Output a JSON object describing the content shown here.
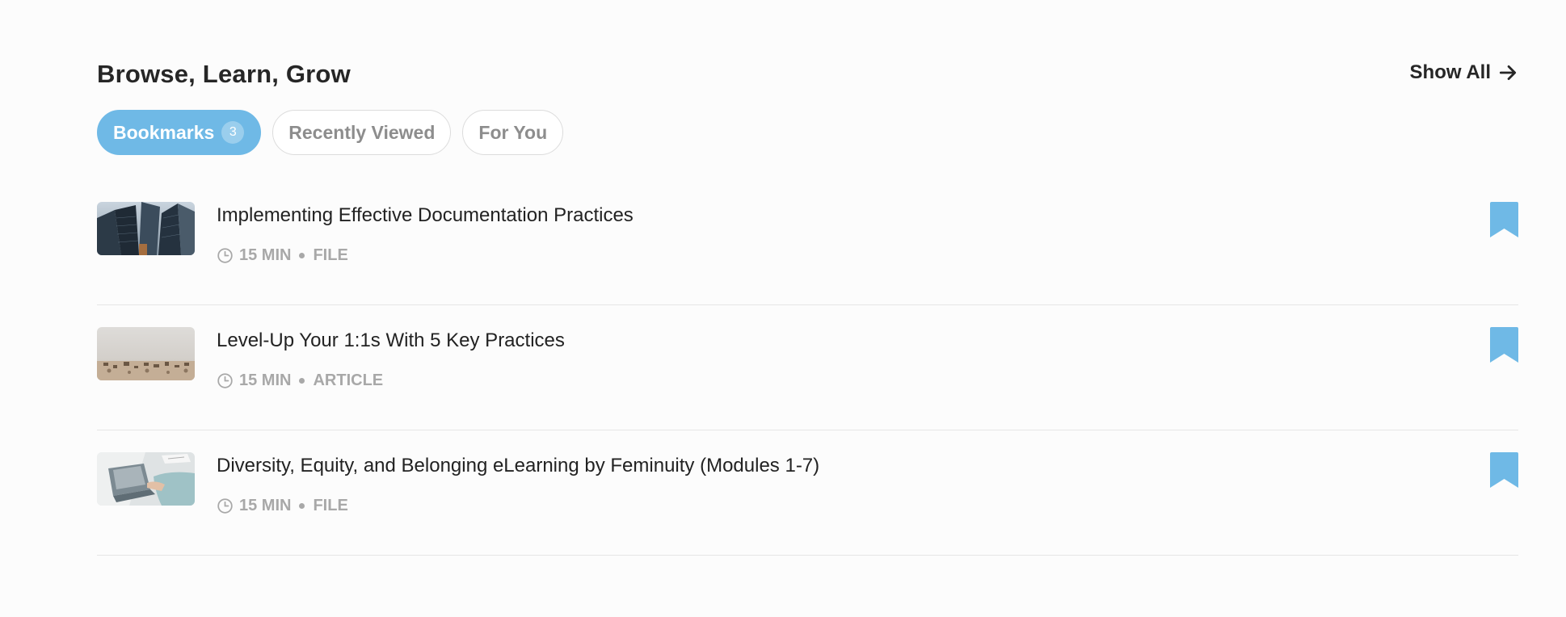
{
  "header": {
    "title": "Browse, Learn, Grow",
    "show_all_label": "Show All"
  },
  "tabs": [
    {
      "label": "Bookmarks",
      "count": "3",
      "active": true
    },
    {
      "label": "Recently Viewed",
      "active": false
    },
    {
      "label": "For You",
      "active": false
    }
  ],
  "items": [
    {
      "title": "Implementing Effective Documentation Practices",
      "duration": "15 MIN",
      "type": "FILE",
      "thumbnail": "skyscrapers"
    },
    {
      "title": "Level-Up Your 1:1s With 5 Key Practices",
      "duration": "15 MIN",
      "type": "ARTICLE",
      "thumbnail": "game-pieces"
    },
    {
      "title": "Diversity, Equity, and Belonging eLearning by Feminuity (Modules 1-7)",
      "duration": "15 MIN",
      "type": "FILE",
      "thumbnail": "laptop-desk"
    }
  ],
  "colors": {
    "accent": "#6fb9e6",
    "muted": "#a8a8a8",
    "border": "#e6e6e6"
  },
  "icons": {
    "show_all": "arrow-right-icon",
    "meta": "clock-icon",
    "item_action": "bookmark-filled-icon"
  }
}
